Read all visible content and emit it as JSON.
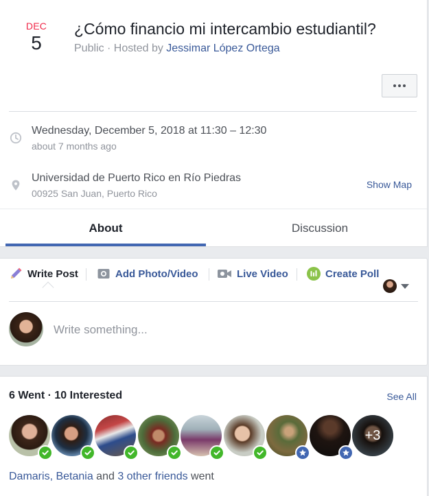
{
  "event": {
    "month": "DEC",
    "day": "5",
    "title": "¿Cómo financio mi intercambio estudiantil?",
    "privacy": "Public",
    "hosted_by_prefix": " · Hosted by ",
    "host": "Jessimar López Ortega",
    "more_icon": "ellipsis-icon"
  },
  "details": {
    "time": {
      "icon": "clock-icon",
      "main": "Wednesday, December 5, 2018 at 11:30 – 12:30",
      "sub": "about 7 months ago"
    },
    "location": {
      "icon": "map-pin-icon",
      "main": "Universidad de Puerto Rico en Río Piedras",
      "sub": "00925 San Juan, Puerto Rico",
      "show_map": "Show Map"
    }
  },
  "tabs": [
    {
      "label": "About",
      "active": true
    },
    {
      "label": "Discussion",
      "active": false
    }
  ],
  "composer": {
    "actions": [
      {
        "label": "Write Post",
        "icon": "pencil-icon",
        "active": true
      },
      {
        "label": "Add Photo/Video",
        "icon": "camera-icon",
        "active": false
      },
      {
        "label": "Live Video",
        "icon": "video-camera-icon",
        "active": false
      },
      {
        "label": "Create Poll",
        "icon": "poll-icon",
        "active": false
      }
    ],
    "placeholder": "Write something..."
  },
  "guests": {
    "title": "6 Went · 10 Interested",
    "see_all": "See All",
    "more_count": "+3",
    "avatars": [
      {
        "status": "went"
      },
      {
        "status": "went"
      },
      {
        "status": "went"
      },
      {
        "status": "went"
      },
      {
        "status": "went"
      },
      {
        "status": "went"
      },
      {
        "status": "interested"
      },
      {
        "status": "interested"
      },
      {
        "status": "more"
      }
    ],
    "friends": {
      "names": "Damaris, Betania",
      "and": " and ",
      "others": "3 other friends",
      "suffix": " went"
    }
  },
  "colors": {
    "accent": "#4267b2",
    "link": "#385898",
    "date_month": "#f02849",
    "went_badge": "#42b72a",
    "poll_icon": "#8bc34a"
  }
}
